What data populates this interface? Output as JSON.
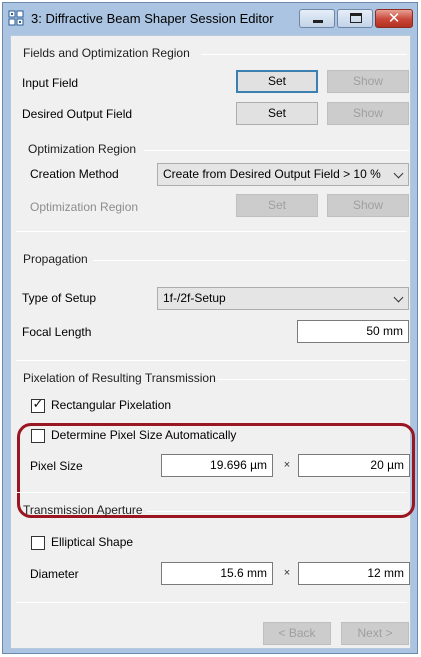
{
  "window": {
    "title": "3: Diffractive Beam Shaper Session Editor",
    "icons": {
      "app": "grid-app-icon",
      "minimize": "minimize-icon",
      "maximize": "maximize-icon",
      "close": "close-icon"
    },
    "close_glyph": "✕",
    "accent_colors": {
      "titlebar": "#aac4e2",
      "close_button": "#c9463a",
      "highlight_border": "#9a1620",
      "focus_border": "#3c7fb1"
    }
  },
  "fields_section": {
    "title": "Fields and Optimization Region",
    "input_field": {
      "label": "Input Field",
      "set": "Set",
      "show": "Show"
    },
    "desired_output_field": {
      "label": "Desired Output Field",
      "set": "Set",
      "show": "Show"
    },
    "optimization_region_group": {
      "title": "Optimization Region",
      "creation_method": {
        "label": "Creation Method",
        "value": "Create from Desired Output Field > 10 %"
      },
      "optimization_region": {
        "label": "Optimization Region",
        "set": "Set",
        "show": "Show"
      }
    }
  },
  "propagation": {
    "title": "Propagation",
    "type_of_setup": {
      "label": "Type of Setup",
      "value": "1f-/2f-Setup"
    },
    "focal_length": {
      "label": "Focal Length",
      "value": "50 mm"
    }
  },
  "pixelation": {
    "title": "Pixelation of Resulting Transmission",
    "rectangular": {
      "label": "Rectangular Pixelation",
      "checked": true,
      "mark": "✓"
    },
    "determine_auto": {
      "label": "Determine Pixel Size Automatically",
      "checked": false
    },
    "pixel_size": {
      "label": "Pixel Size",
      "x": "19.696 µm",
      "sep": "×",
      "y": "20 µm"
    }
  },
  "aperture": {
    "title": "Transmission Aperture",
    "elliptical": {
      "label": "Elliptical Shape",
      "checked": false
    },
    "diameter": {
      "label": "Diameter",
      "x": "15.6 mm",
      "sep": "×",
      "y": "12 mm"
    }
  },
  "footer": {
    "back": "< Back",
    "next": "Next >"
  }
}
